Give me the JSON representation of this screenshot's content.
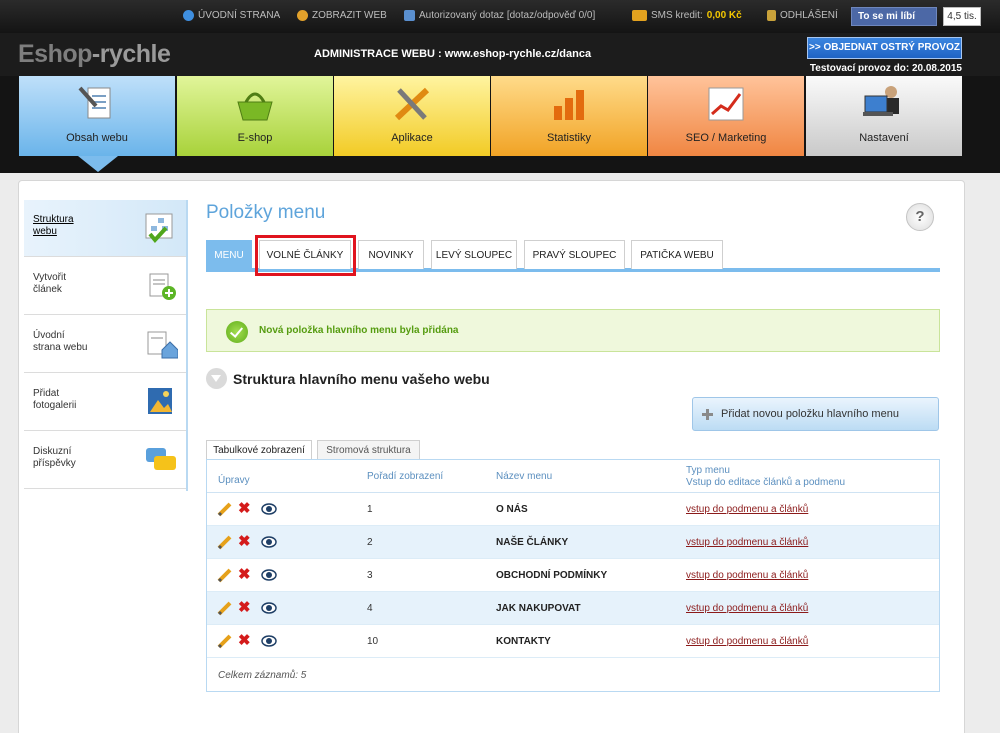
{
  "topbar": {
    "home": "ÚVODNÍ STRANA",
    "view_web": "ZOBRAZIT WEB",
    "query": "Autorizovaný dotaz [dotaz/odpověď 0/0]",
    "sms_label": "SMS kredit:",
    "sms_value": "0,00 Kč",
    "logout": "ODHLÁŠENÍ",
    "fb_like": "To se mi líbí",
    "fb_count": "4,5 tis."
  },
  "header": {
    "logo_left": "Eshop",
    "logo_right": "-rychle",
    "admin": "ADMINISTRACE WEBU : www.eshop-rychle.cz/danca",
    "order_button": ">> OBJEDNAT OSTRÝ PROVOZ",
    "test_until": "Testovací provoz do: 20.08.2015"
  },
  "nav": [
    "Obsah webu",
    "E-shop",
    "Aplikace",
    "Statistiky",
    "SEO / Marketing",
    "Nastavení"
  ],
  "sidebar": [
    {
      "label1": "Struktura",
      "label2": "webu"
    },
    {
      "label1": "Vytvořit",
      "label2": "článek"
    },
    {
      "label1": "Úvodní",
      "label2": "strana webu"
    },
    {
      "label1": "Přidat",
      "label2": "fotogalerii"
    },
    {
      "label1": "Diskuzní",
      "label2": "příspěvky"
    }
  ],
  "page": {
    "title": "Položky menu",
    "help": "?",
    "tabs": [
      "MENU",
      "VOLNÉ ČLÁNKY",
      "NOVINKY",
      "LEVÝ SLOUPEC",
      "PRAVÝ SLOUPEC",
      "PATIČKA WEBU"
    ],
    "success": "Nová položka hlavního menu byla přidána",
    "section_title": "Struktura hlavního menu vašeho webu",
    "add_button": "Přidat novou položku hlavního menu",
    "view_tabs": [
      "Tabulkové zobrazení",
      "Stromová struktura"
    ]
  },
  "table": {
    "headers": {
      "edit": "Úpravy",
      "order": "Pořadí zobrazení",
      "name": "Název menu",
      "type1": "Typ menu",
      "type2": "Vstup do editace článků a podmenu"
    },
    "rows": [
      {
        "order": "1",
        "name": "O NÁS",
        "link": "vstup do podmenu a článků"
      },
      {
        "order": "2",
        "name": "NAŠE ČLÁNKY",
        "link": "vstup do podmenu a článků"
      },
      {
        "order": "3",
        "name": "OBCHODNÍ PODMÍNKY",
        "link": "vstup do podmenu a článků"
      },
      {
        "order": "4",
        "name": "JAK NAKUPOVAT",
        "link": "vstup do podmenu a článků"
      },
      {
        "order": "10",
        "name": "KONTAKTY",
        "link": "vstup do podmenu a článků"
      }
    ],
    "total": "Celkem záznamů: 5"
  },
  "colors": {
    "accent": "#7cbced",
    "highlight": "#e0141e",
    "success": "#559c10",
    "link": "#8b1a1a"
  }
}
